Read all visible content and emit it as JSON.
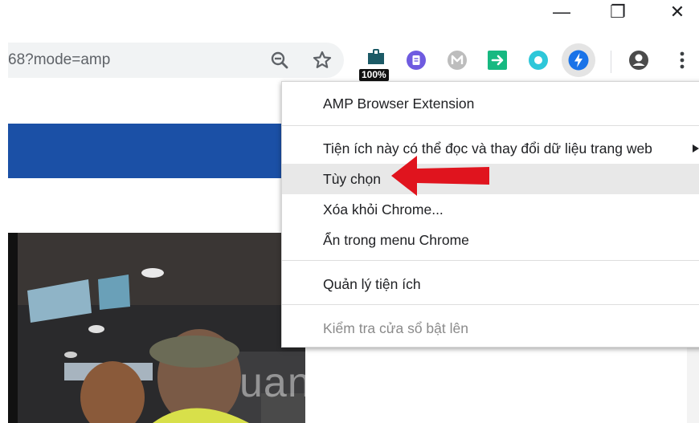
{
  "window": {
    "controls": {
      "minimize": "—",
      "maximize": "❐",
      "close": "✕"
    }
  },
  "toolbar": {
    "url_text": "68?mode=amp",
    "zoom_icon": "zoom-out-icon",
    "star_icon": "star-icon",
    "extension_badge": "100%",
    "extensions": [
      "page-zoom-icon",
      "purple-clipboard-icon",
      "gray-m-icon",
      "green-arrow-icon",
      "teal-circle-icon",
      "amp-bolt-icon"
    ],
    "profile_icon": "profile-icon",
    "menu_icon": "kebab-menu-icon"
  },
  "context_menu": {
    "title": "AMP Browser Extension",
    "items": [
      {
        "label": "Tiện ích này có thể đọc và thay đổi dữ liệu trang web",
        "has_submenu": true
      },
      {
        "label": "Tùy chọn",
        "highlighted": true
      },
      {
        "label": "Xóa khỏi Chrome..."
      },
      {
        "label": "Ẩn trong menu Chrome"
      }
    ],
    "manage": "Quản lý tiện ích",
    "disabled_item": "Kiểm tra cửa sổ bật lên"
  },
  "page": {
    "watermark": "uantrimang"
  },
  "colors": {
    "blue_band": "#1b50a6",
    "arrow_red": "#e0141e",
    "amp_blue": "#1a73e8"
  }
}
